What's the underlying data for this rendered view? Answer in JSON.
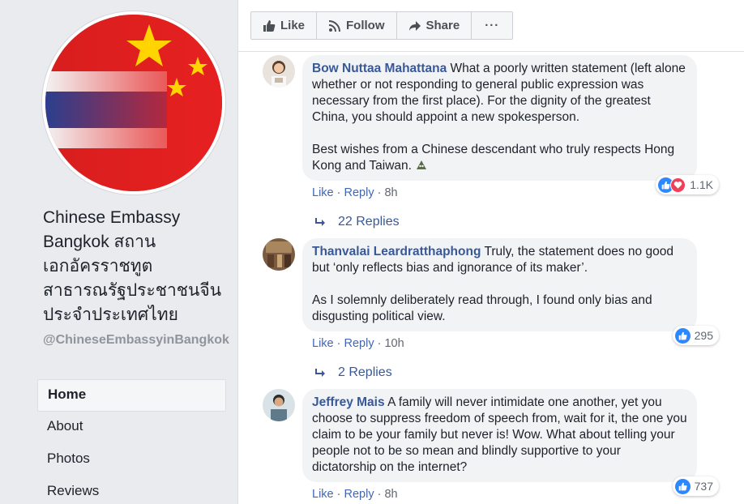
{
  "page": {
    "name": "Chinese Embassy Bangkok สถานเอกอัครราชทูตสาธารณรัฐประชาชนจีนประจำประเทศไทย",
    "handle": "@ChineseEmbassyinBangkok"
  },
  "nav": {
    "items": [
      {
        "label": "Home",
        "active": true
      },
      {
        "label": "About",
        "active": false
      },
      {
        "label": "Photos",
        "active": false
      },
      {
        "label": "Reviews",
        "active": false
      }
    ]
  },
  "actions": {
    "like": "Like",
    "follow": "Follow",
    "share": "Share",
    "more": "···"
  },
  "comments": [
    {
      "author": "Bow Nuttaa Mahattana",
      "text": "What a poorly written statement (left alone whether or not responding to general public expression was necessary from the first place). For the dignity of the greatest China, you should appoint a new spokesperson.",
      "text2": "Best wishes from a Chinese descendant who truly respects Hong Kong and Taiwan.",
      "like_label": "Like",
      "reply_label": "Reply",
      "time": "8h",
      "reactions": "1.1K",
      "replies": "22 Replies"
    },
    {
      "author": "Thanvalai Leardratthaphong",
      "text": "Truly, the statement does no good but ‘only reflects bias and ignorance of its maker’.",
      "text2": "As I solemnly deliberately read through, I found only bias and disgusting political view.",
      "like_label": "Like",
      "reply_label": "Reply",
      "time": "10h",
      "reactions": "295",
      "replies": "2 Replies"
    },
    {
      "author": "Jeffrey Mais",
      "text": "A family will never intimidate one another, yet you choose to suppress freedom of speech from, wait for it, the one you claim to be your family but never is! Wow. What about telling your people not to be so mean and blindly supportive to your dictatorship on the internet?",
      "like_label": "Like",
      "reply_label": "Reply",
      "time": "8h",
      "reactions": "737"
    }
  ],
  "colors": {
    "link_blue": "#385898",
    "like_blue": "#2d88ff",
    "love_red": "#f33e58",
    "bubble_bg": "#f2f3f5"
  }
}
